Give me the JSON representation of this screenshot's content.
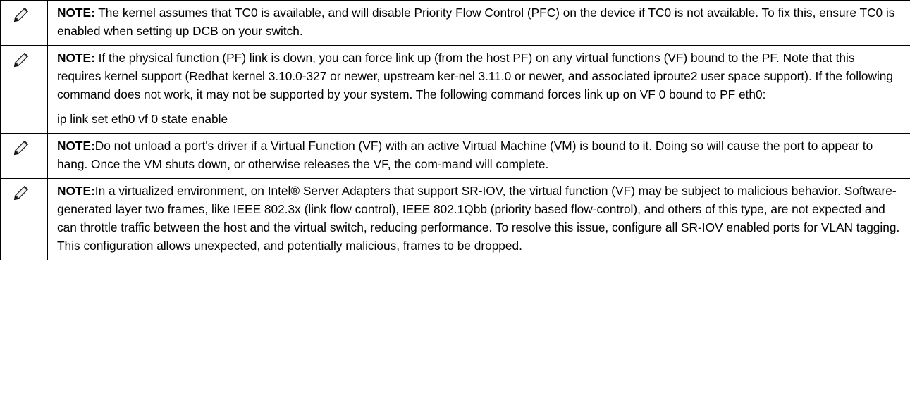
{
  "notes": [
    {
      "icon": "pencil-note-icon",
      "label": "NOTE:",
      "text": " The kernel assumes that TC0 is available, and will disable Priority Flow Control (PFC) on the device if TC0 is not available. To fix this, ensure TC0 is enabled when setting up DCB on your switch."
    },
    {
      "icon": "pencil-note-icon",
      "label": "NOTE:",
      "text": " If the physical function (PF) link is down, you can force link up (from the host PF) on any virtual functions (VF) bound to the PF. Note that this requires kernel support (Redhat kernel 3.10.0-327 or newer, upstream ker-nel 3.11.0 or newer, and associated iproute2 user space support). If the following command does not work, it may not be supported by your system. The following command forces link up on VF 0 bound to PF eth0:",
      "command": "ip link set eth0 vf 0 state enable"
    },
    {
      "icon": "pencil-note-icon",
      "label": "NOTE:",
      "text": "Do not unload a port's driver if a Virtual Function (VF) with an active Virtual Machine (VM) is bound to it. Doing so will cause the port to appear to hang. Once the VM shuts down, or otherwise releases the VF, the com-mand will complete."
    },
    {
      "icon": "pencil-note-icon",
      "label": "NOTE:",
      "text": "In a virtualized environment, on Intel® Server Adapters that support SR-IOV, the virtual function (VF) may be subject to malicious behavior. Software- generated layer two frames, like IEEE 802.3x (link flow control), IEEE 802.1Qbb (priority based flow-control), and others of this type, are not expected and can throttle traffic between the host and the virtual switch, reducing performance. To resolve this issue, configure all SR-IOV enabled ports for VLAN tagging. This configuration allows unexpected, and potentially malicious, frames to be dropped."
    }
  ]
}
